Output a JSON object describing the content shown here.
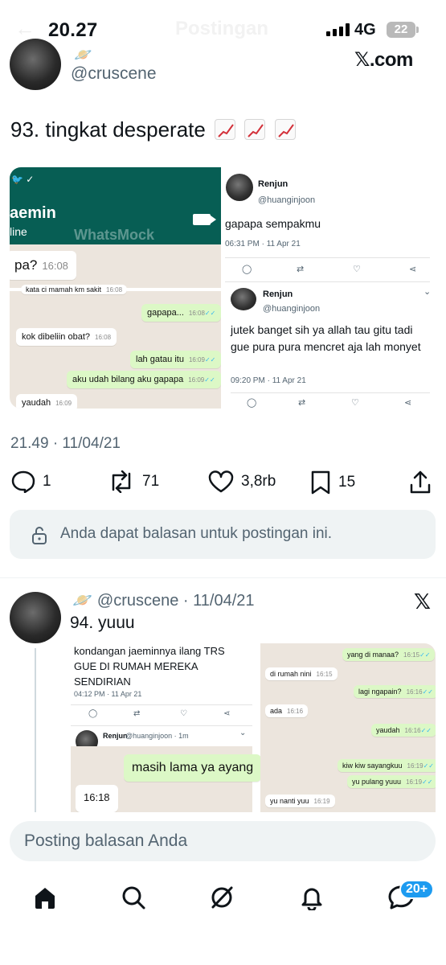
{
  "status_bar": {
    "time": "20.27",
    "network": "4G",
    "battery": "22",
    "ghost_title": "Postingan"
  },
  "post1": {
    "handle": "@cruscene",
    "emoji": "🪐",
    "source": "𝕏.com",
    "text": "93. tingkat desperate",
    "chat_screenshot": {
      "contact_name": "aemin",
      "contact_status": "line",
      "watermark": "WhatsMock",
      "messages": [
        {
          "text": "pa?",
          "time": "16:08",
          "dir": "in"
        },
        {
          "text": "kata ci mamah km sakit",
          "time": "16:08",
          "dir": "in"
        },
        {
          "text": "gapapa...",
          "time": "16:08",
          "dir": "out"
        },
        {
          "text": "kok dibeliin obat?",
          "time": "16:08",
          "dir": "in"
        },
        {
          "text": "lah gatau itu",
          "time": "16:09",
          "dir": "out"
        },
        {
          "text": "aku udah bilang aku gapapa",
          "time": "16:09",
          "dir": "out"
        },
        {
          "text": "yaudah",
          "time": "16:09",
          "dir": "in"
        }
      ]
    },
    "tweet_screenshot": {
      "name": "Renjun",
      "handle": "@huanginjoon",
      "tweet1": "gapapa sempakmu",
      "date1": "06:31 PM · 11 Apr 21",
      "tweet2": "jutek banget sih ya allah tau gitu tadi gue pura pura mencret aja lah monyet",
      "date2": "09:20 PM · 11 Apr 21"
    },
    "timestamp": "21.49 · 11/04/21",
    "stats": {
      "replies": "1",
      "reposts": "71",
      "likes": "3,8rb",
      "bookmarks": "15"
    },
    "reply_notice": "Anda dapat balasan untuk postingan ini."
  },
  "post2": {
    "emoji": "🪐",
    "handle": "@cruscene",
    "date": "11/04/21",
    "text": "94. yuuu",
    "tweet_snippet": "kondangan jaeminnya ilang TRS GUE DI RUMAH MEREKA SENDIRIAN",
    "tweet_date": "04:12 PM · 11 Apr 21",
    "reply_name": "Renjun",
    "reply_handle": "@huanginjoon · 1m",
    "chat_a": [
      {
        "text": "yang di manaa?",
        "time": "16:15",
        "dir": "out"
      },
      {
        "text": "di rumah nini",
        "time": "16:15",
        "dir": "in"
      },
      {
        "text": "lagi ngapain?",
        "time": "16:16",
        "dir": "out"
      },
      {
        "text": "ada",
        "time": "16:16",
        "dir": "in"
      },
      {
        "text": "yaudah",
        "time": "16:16",
        "dir": "out"
      }
    ],
    "chat_big": {
      "text": "masih lama ya ayang",
      "time": "16:18"
    },
    "chat_b": [
      {
        "text": "kiw kiw sayangkuu",
        "time": "16:19",
        "dir": "out"
      },
      {
        "text": "yu pulang yuuu",
        "time": "16:19",
        "dir": "out"
      },
      {
        "text": "yu nanti yuu",
        "time": "16:19",
        "dir": "in"
      }
    ]
  },
  "compose": {
    "placeholder": "Posting balasan Anda"
  },
  "tabs": {
    "messages_badge": "20+"
  },
  "colors": {
    "accent": "#1d9bf0",
    "muted": "#536471",
    "wa_header": "#075e54",
    "wa_out": "#dcf8c6"
  }
}
